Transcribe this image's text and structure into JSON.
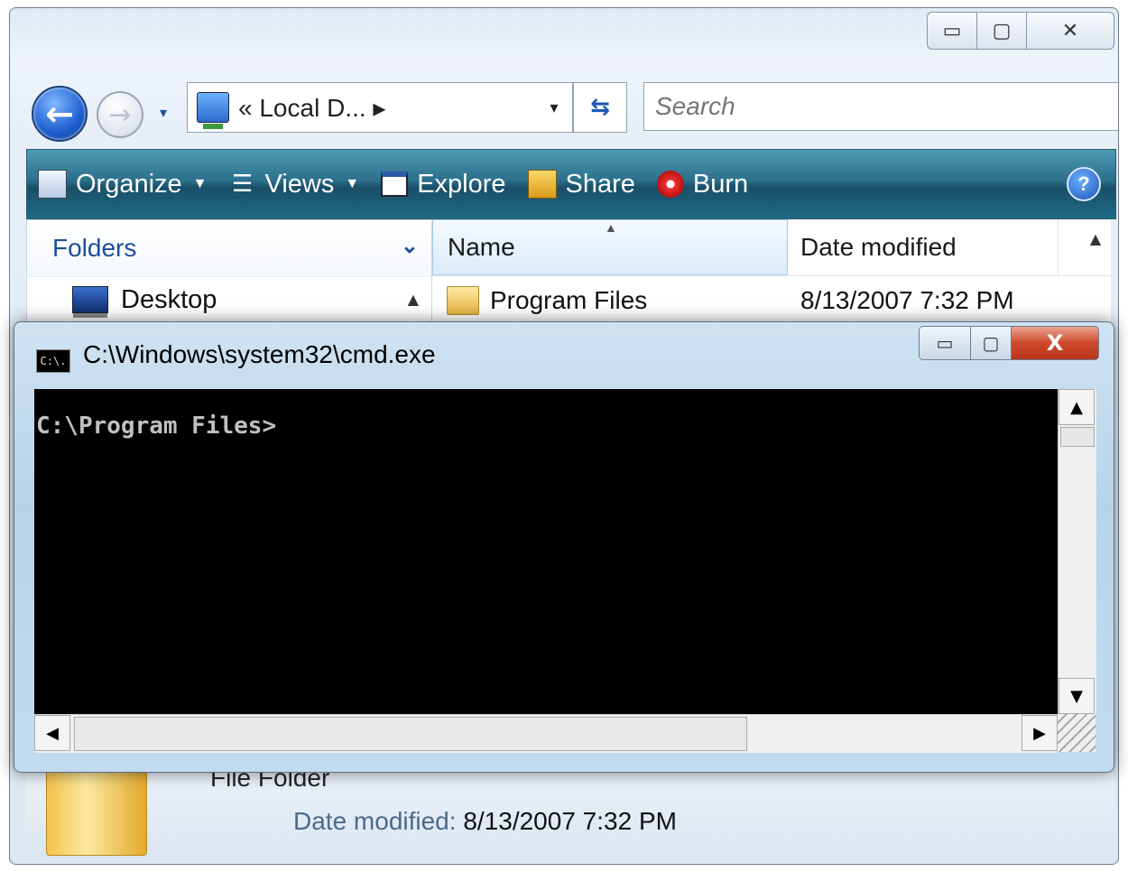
{
  "explorer": {
    "caption_buttons": {
      "minimize": "▭",
      "maximize": "▢",
      "close": "✕"
    },
    "nav": {
      "back_glyph": "←",
      "forward_glyph": "→",
      "recent_glyph": "▾"
    },
    "address": {
      "crumb": "« Local D... ▸",
      "dropdown_glyph": "▾",
      "refresh_glyph": "⇆"
    },
    "search": {
      "placeholder": "Search"
    },
    "commandbar": {
      "organize": "Organize",
      "views": "Views",
      "explore": "Explore",
      "share": "Share",
      "burn": "Burn",
      "help": "?"
    },
    "navpane": {
      "header": "Folders",
      "items": [
        {
          "label": "Desktop"
        }
      ]
    },
    "filelist": {
      "columns": {
        "name": "Name",
        "date": "Date modified"
      },
      "rows": [
        {
          "name": "Program Files",
          "date": "8/13/2007 7:32 PM"
        }
      ]
    },
    "details": {
      "type": "File Folder",
      "date_label": "Date modified:",
      "date_value": "8/13/2007 7:32 PM"
    }
  },
  "cmd": {
    "title": "C:\\Windows\\system32\\cmd.exe",
    "icon_text": "C:\\.",
    "caption_buttons": {
      "minimize": "▭",
      "maximize": "▢",
      "close": "X"
    },
    "prompt": "C:\\Program Files>",
    "scroll_glyphs": {
      "up": "▲",
      "down": "▼",
      "left": "◀",
      "right": "▶"
    }
  },
  "colors": {
    "console_bg": "#000000",
    "console_fg": "#c0c0c0",
    "commandbar": "#2b6f8b",
    "close_red": "#cf4a2b",
    "link_blue": "#1c4f9a"
  }
}
